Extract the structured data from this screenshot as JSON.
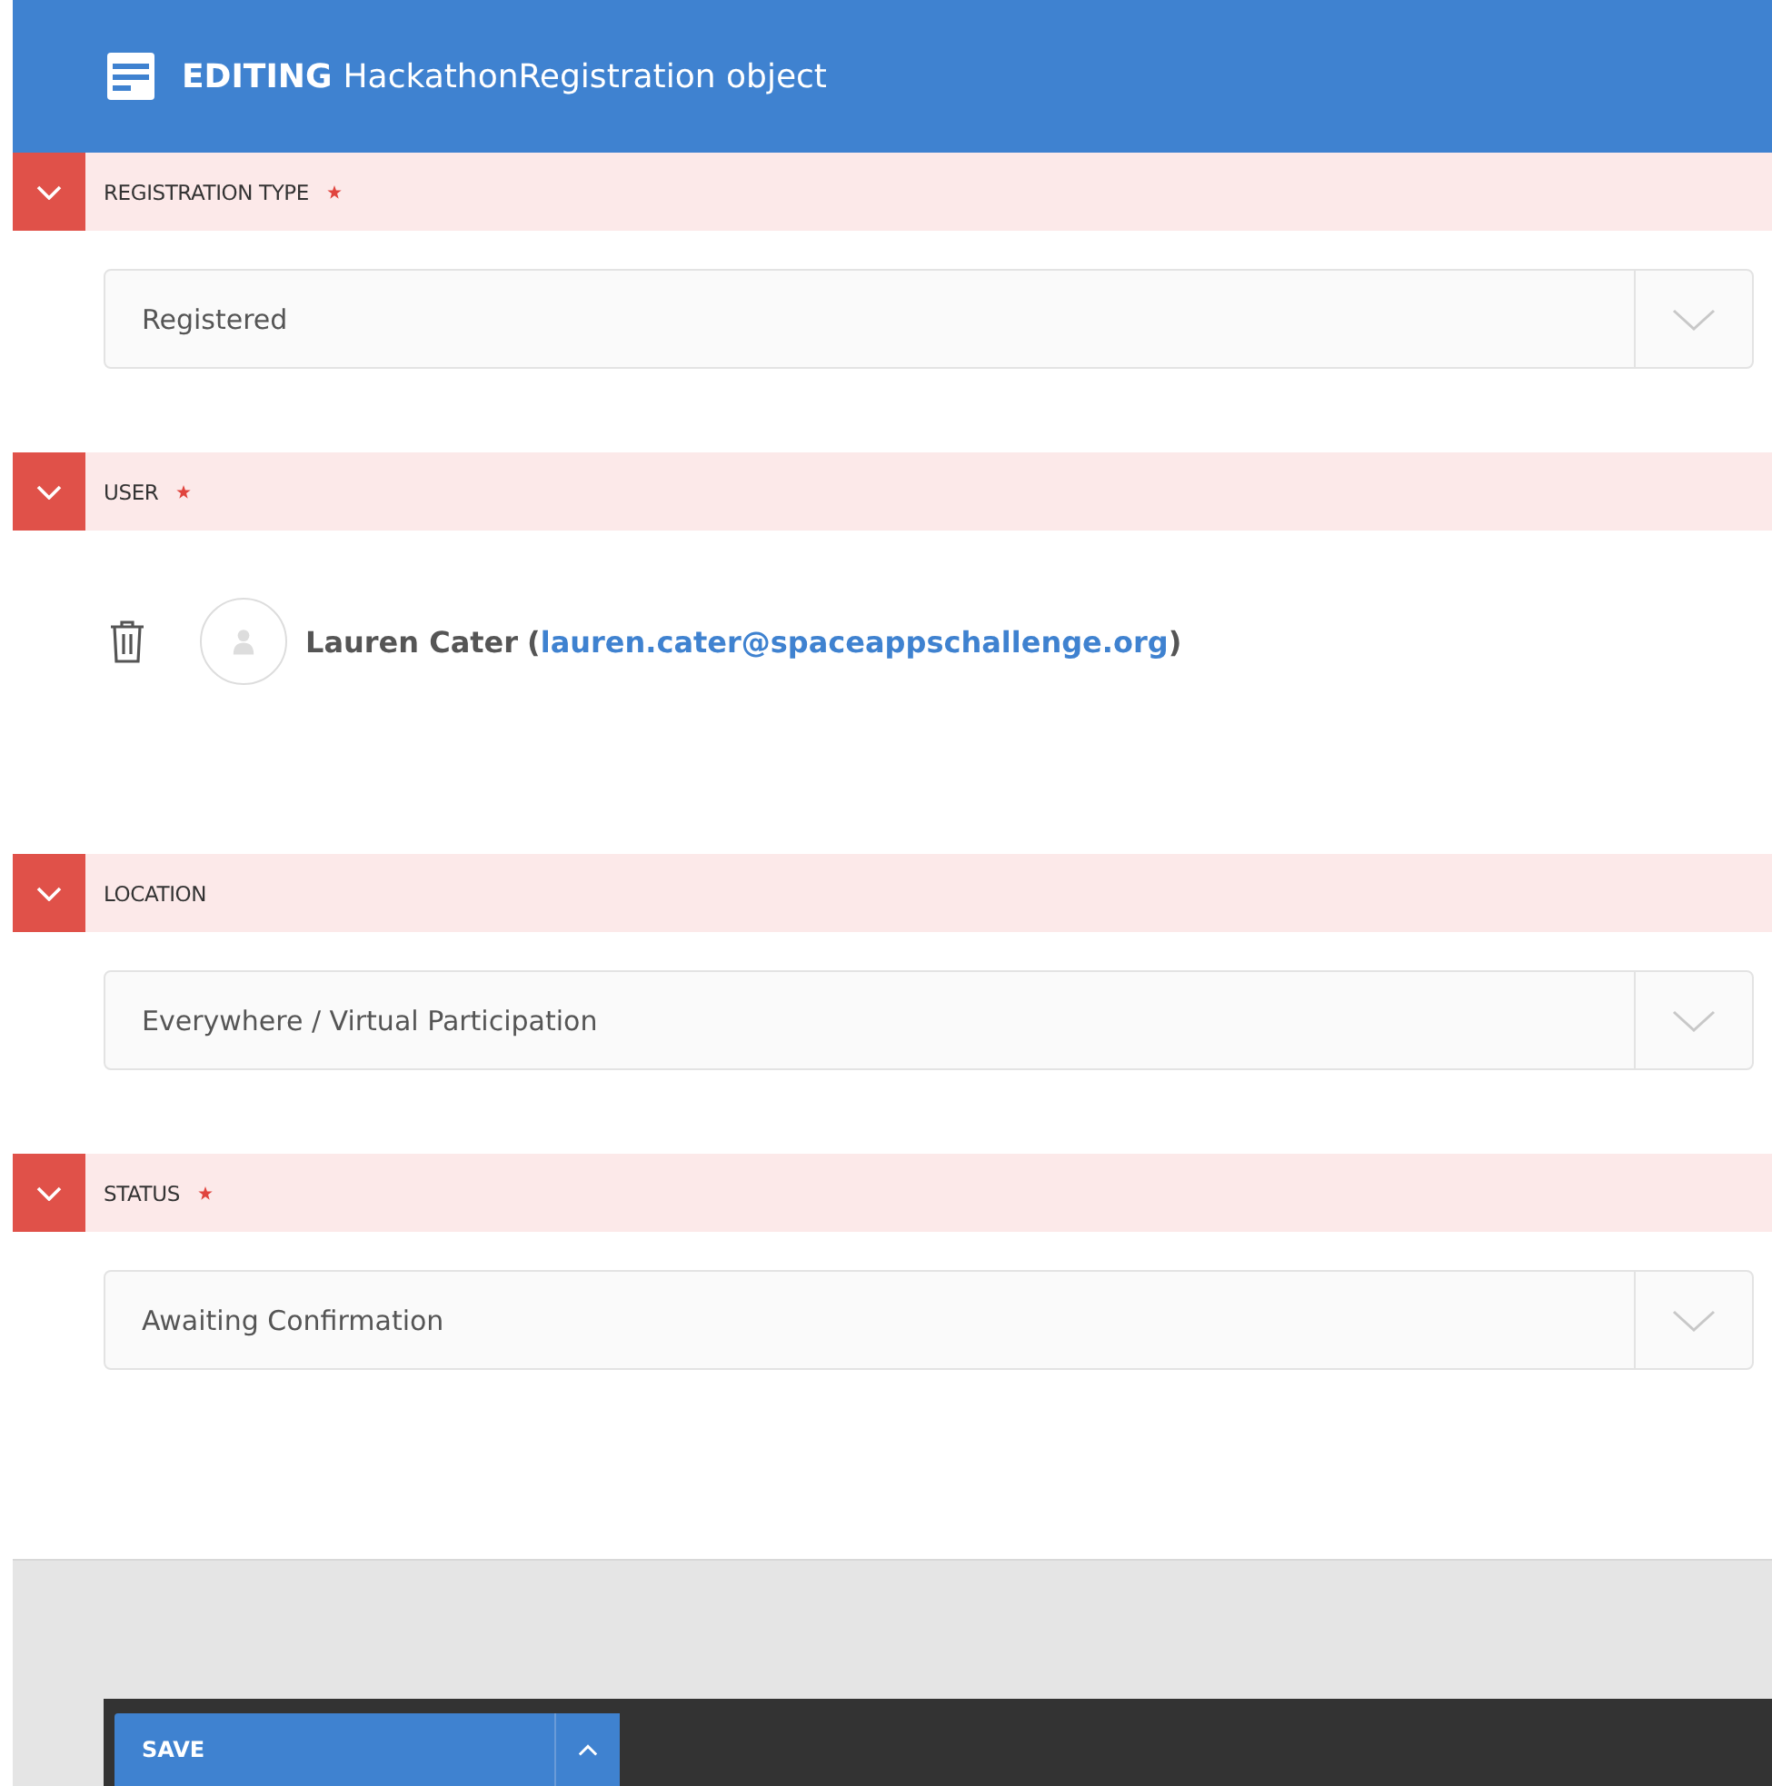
{
  "header": {
    "title_bold": "EDITING",
    "title": "HackathonRegistration object"
  },
  "sections": [
    {
      "kind": "select",
      "label": "REGISTRATION TYPE",
      "required": true,
      "value": "Registered"
    },
    {
      "kind": "user",
      "label": "USER",
      "required": true,
      "user_name": "Lauren Cater",
      "paren_open": "(",
      "email": "lauren.cater@spaceappschallenge.org",
      "paren_close": ")"
    },
    {
      "kind": "select",
      "label": "LOCATION",
      "required": false,
      "value": "Everywhere / Virtual Participation"
    },
    {
      "kind": "select",
      "label": "STATUS",
      "required": true,
      "value": "Awaiting Confirmation"
    }
  ],
  "footer": {
    "save_label": "SAVE"
  }
}
